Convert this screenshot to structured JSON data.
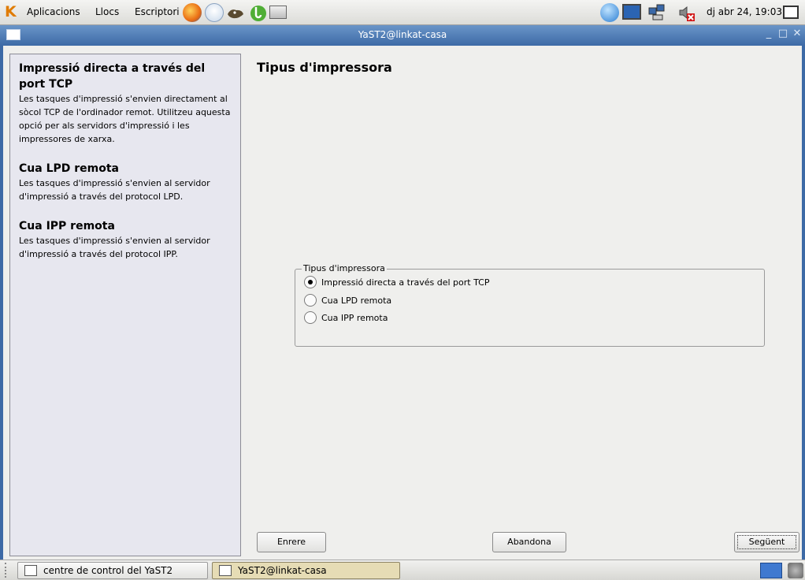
{
  "top_panel": {
    "menus": [
      "Aplicacions",
      "Llocs",
      "Escriptori"
    ],
    "clock": "dj abr 24, 19:03"
  },
  "window": {
    "title": "YaST2@linkat-casa"
  },
  "help": [
    {
      "title": "Impressió directa a través del port TCP",
      "text": "Les tasques d'impressió s'envien directament al sòcol TCP de l'ordinador remot. Utilitzeu aquesta opció per als servidors d'impressió i les impressores de xarxa."
    },
    {
      "title": "Cua LPD remota",
      "text": "Les tasques d'impressió s'envien al servidor d'impressió a través del protocol LPD."
    },
    {
      "title": "Cua IPP remota",
      "text": "Les tasques d'impressió s'envien al servidor d'impressió a través del protocol IPP."
    }
  ],
  "main": {
    "title": "Tipus d'impressora",
    "frame_label": "Tipus d'impressora",
    "options": [
      {
        "label": "Impressió directa a través del port TCP",
        "selected": true
      },
      {
        "label": "Cua LPD remota",
        "selected": false
      },
      {
        "label": "Cua IPP remota",
        "selected": false
      }
    ]
  },
  "buttons": {
    "back": "Enrere",
    "abort": "Abandona",
    "next": "Següent"
  },
  "taskbar": {
    "items": [
      "centre de control del YaST2",
      "YaST2@linkat-casa"
    ]
  },
  "colors": {
    "titlebar": "#3d6aa6",
    "help_bg": "#e7e7ef"
  }
}
